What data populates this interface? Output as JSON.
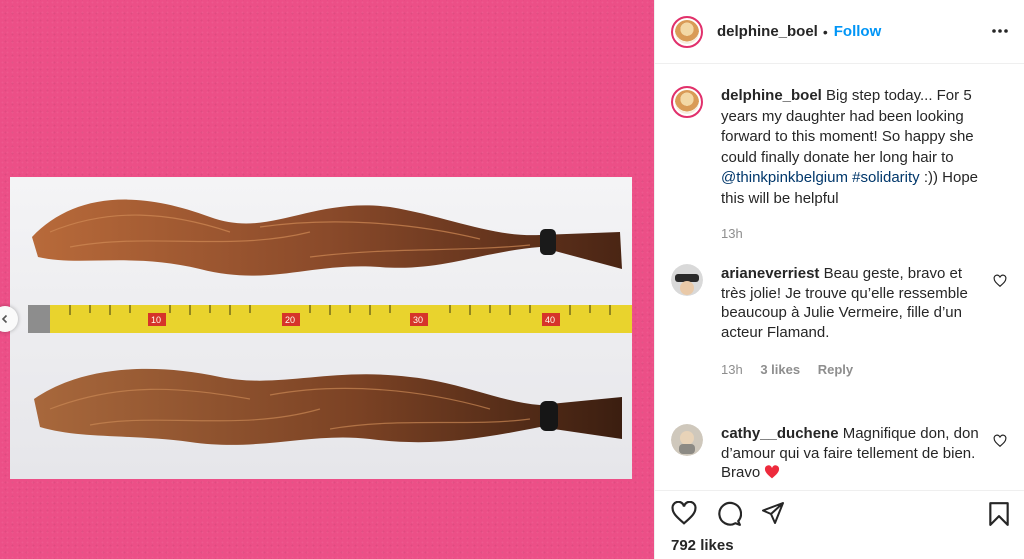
{
  "post": {
    "username": "delphine_boel",
    "follow_label": "Follow",
    "caption": {
      "username": "delphine_boel",
      "text_1": "Big step today... For 5 years my daughter had been looking forward to this moment! So happy she could finally donate her long hair to ",
      "mention": "@thinkpinkbelgium",
      "hashtag": "#solidarity",
      "text_2": " :)) Hope this will be helpful",
      "time": "13h"
    },
    "comments": [
      {
        "username": "arianeverriest",
        "text": "Beau geste, bravo et très jolie! Je trouve qu’elle ressemble beaucoup à Julie Vermeire, fille d’un acteur Flamand.",
        "time": "13h",
        "likes": "3 likes",
        "reply": "Reply"
      },
      {
        "username": "cathy__duchene",
        "text": "Magnifique don, don d’amour qui va faire tellement de bien. Bravo",
        "emoji": "heart-emoji"
      }
    ],
    "likes_count": "792 likes"
  },
  "photo": {
    "tape_numbers": [
      "10",
      "20",
      "30",
      "40"
    ]
  },
  "icons": {
    "more": "more-horizontal-icon",
    "like": "heart-icon",
    "comment": "comment-bubble-icon",
    "share": "paper-plane-icon",
    "save": "bookmark-icon",
    "prev": "chevron-left-icon"
  },
  "colors": {
    "background": "#ec4f87",
    "accent": "#0095f6",
    "link": "#00376b",
    "heart_emoji": "#ed2a3c"
  }
}
